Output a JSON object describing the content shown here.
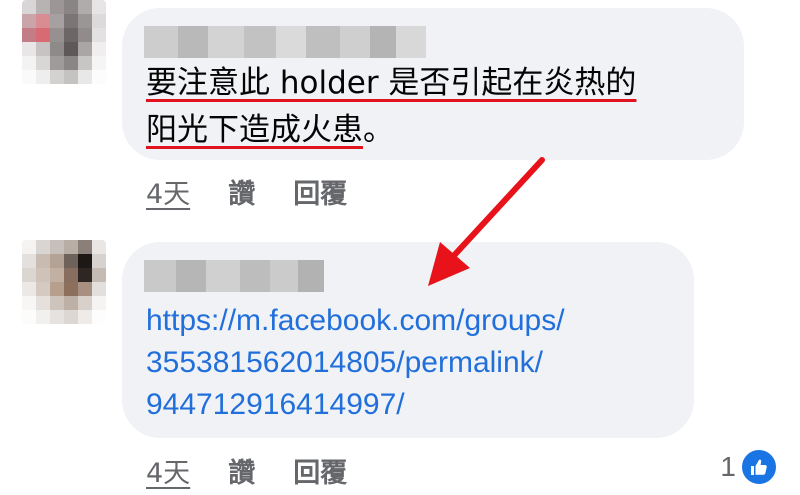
{
  "comments": [
    {
      "text_lines": [
        "要注意此 holder 是否引起在炎热的",
        "阳光下造成火患",
        "。"
      ],
      "actions": {
        "time": "4天",
        "like": "讚",
        "reply": "回覆"
      }
    },
    {
      "link_lines": [
        "https://m.facebook.com/groups/",
        "355381562014805/permalink/",
        "944712916414997/"
      ],
      "actions": {
        "time": "4天",
        "like": "讚",
        "reply": "回覆"
      },
      "reactions": {
        "count": "1",
        "icon": "thumbs-up-icon"
      }
    }
  ],
  "annotation": {
    "arrow_color": "#e8121b",
    "underline_color": "#e0141e"
  }
}
